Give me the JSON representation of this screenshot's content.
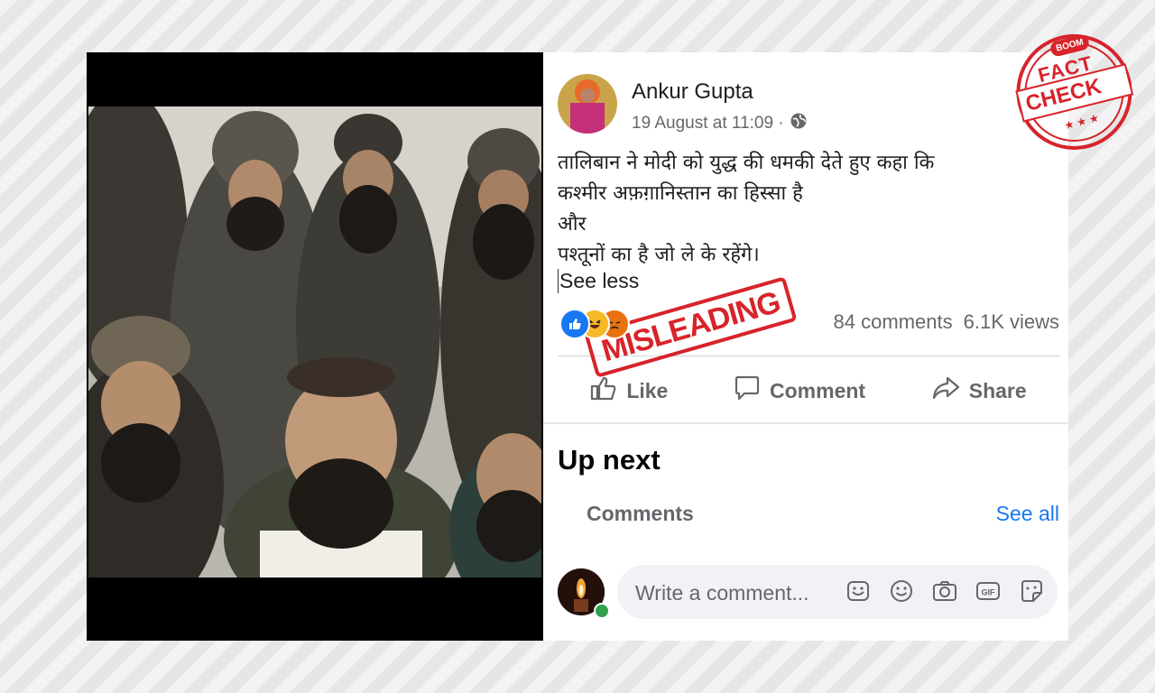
{
  "post": {
    "author": "Ankur Gupta",
    "date": "19 August at 11:09 ·",
    "text_lines": [
      "तालिबान ने मोदी को युद्ध की धमकी देते हुए कहा कि",
      "कश्मीर अफ़ग़ानिस्तान का हिस्सा है",
      "और",
      "पश्तूनों का है जो ले के रहेंगे।"
    ],
    "see_less": "See less",
    "comments_count": "84 comments",
    "views_count": "6.1K views"
  },
  "actions": {
    "like": "Like",
    "comment": "Comment",
    "share": "Share"
  },
  "up_next": "Up next",
  "comments_section": {
    "label": "Comments",
    "see_all": "See all",
    "placeholder": "Write a comment..."
  },
  "stamps": {
    "misleading": "MISLEADING",
    "fact_check_top": "FACT",
    "fact_check_bottom": "CHECK",
    "brand": "BOOM"
  },
  "colors": {
    "stamp_red": "#d8232a",
    "link_blue": "#1877f2",
    "secondary_text": "#65676b"
  },
  "icons": [
    "globe-icon",
    "like-reaction-icon",
    "haha-reaction-icon",
    "angry-reaction-icon",
    "like-icon",
    "comment-icon",
    "share-icon",
    "sticker-icon",
    "emoji-icon",
    "camera-icon",
    "gif-icon",
    "avatar-sticker-icon"
  ]
}
